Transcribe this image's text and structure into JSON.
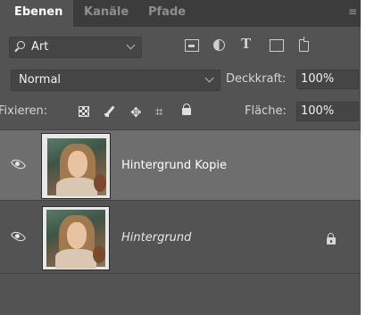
{
  "tabs": [
    {
      "label": "Ebenen",
      "active": true
    },
    {
      "label": "Kanäle",
      "active": false
    },
    {
      "label": "Pfade",
      "active": false
    }
  ],
  "filter": {
    "kind_label": "Art",
    "icons": [
      "pixel-layer-filter-icon",
      "adjustment-layer-filter-icon",
      "type-layer-filter-icon",
      "shape-layer-filter-icon",
      "smart-object-filter-icon"
    ],
    "type_glyph": "T"
  },
  "blend": {
    "mode": "Normal",
    "opacity_label": "Deckkraft:",
    "opacity_value": "100%"
  },
  "lock": {
    "label": "Fixieren:",
    "fill_label": "Fläche:",
    "fill_value": "100%",
    "move_glyph": "✥",
    "artboard_glyph": "⌗"
  },
  "layers": [
    {
      "name": "Hintergrund Kopie",
      "selected": true,
      "locked": false,
      "visible": true
    },
    {
      "name": "Hintergrund",
      "selected": false,
      "locked": true,
      "visible": true
    }
  ],
  "colors": {
    "panel": "#535353",
    "tabbar": "#3c3c3c",
    "selected_layer": "#6e6e6e"
  }
}
